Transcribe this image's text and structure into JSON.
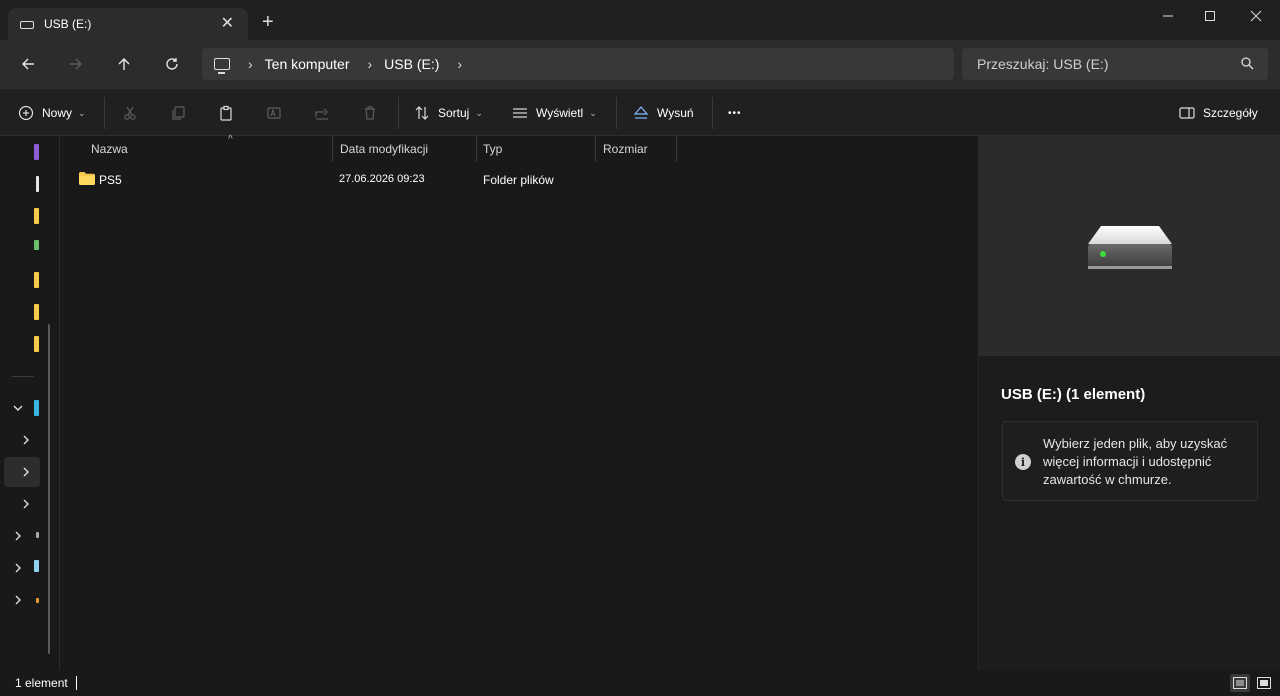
{
  "window": {
    "tab_title": "USB (E:)",
    "tab_close": "✕",
    "new_tab": "+",
    "minimize": "—",
    "maximize": "☐",
    "close": "✕"
  },
  "address_bar": {
    "breadcrumbs": [
      "Ten komputer",
      "USB (E:)"
    ],
    "separator": "›"
  },
  "search": {
    "placeholder": "Przeszukaj: USB (E:)"
  },
  "toolbar": {
    "new_label": "Nowy",
    "sort_label": "Sortuj",
    "view_label": "Wyświetl",
    "eject_label": "Wysuń",
    "more_label": "•••",
    "details_label": "Szczegóły",
    "chevron": "⌄"
  },
  "columns": {
    "name": "Nazwa",
    "modified": "Data modyfikacji",
    "type": "Typ",
    "size": "Rozmiar",
    "sort_indicator": "^"
  },
  "files": [
    {
      "name": "PS5",
      "modified": "27.06.2026 09:23",
      "type": "Folder plików",
      "size": ""
    }
  ],
  "details": {
    "title": "USB (E:) (1 element)",
    "info_icon": "i",
    "info_text": "Wybierz jeden plik, aby uzyskać więcej informacji i udostępnić zawartość w chmurze."
  },
  "status": {
    "item_count": "1 element"
  },
  "colors": {
    "background": "#191919",
    "titlebar": "#202020",
    "addressbar": "#2c2c2c",
    "folder": "#f7c948",
    "drive_led": "#3cdc3c"
  }
}
